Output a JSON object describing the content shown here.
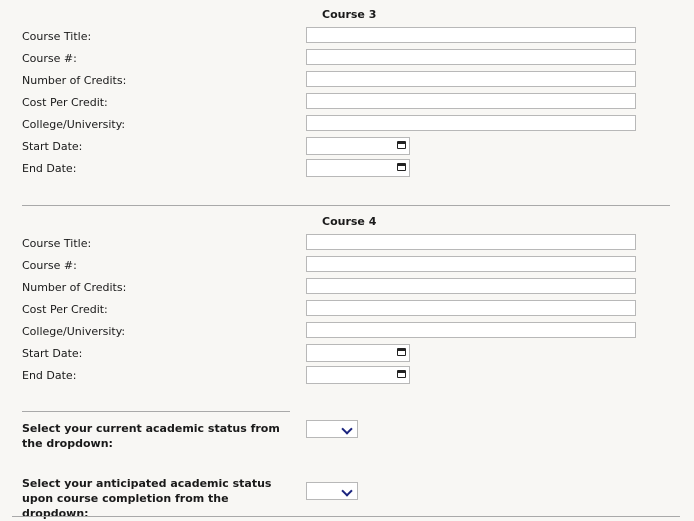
{
  "course3": {
    "title": "Course 3",
    "fields": {
      "course_title": "Course Title:",
      "course_num": "Course #:",
      "credits": "Number of Credits:",
      "cost": "Cost Per Credit:",
      "college": "College/University:",
      "start": "Start Date:",
      "end": "End Date:"
    }
  },
  "course4": {
    "title": "Course 4",
    "fields": {
      "course_title": "Course Title:",
      "course_num": "Course #:",
      "credits": "Number of Credits:",
      "cost": "Cost Per Credit:",
      "college": "College/University:",
      "start": "Start Date:",
      "end": "End Date:"
    }
  },
  "status": {
    "current_label": "Select your current academic status from the dropdown:",
    "current_value": "",
    "anticipated_label": "Select your anticipated academic status upon course completion from the dropdown:",
    "anticipated_value": ""
  }
}
